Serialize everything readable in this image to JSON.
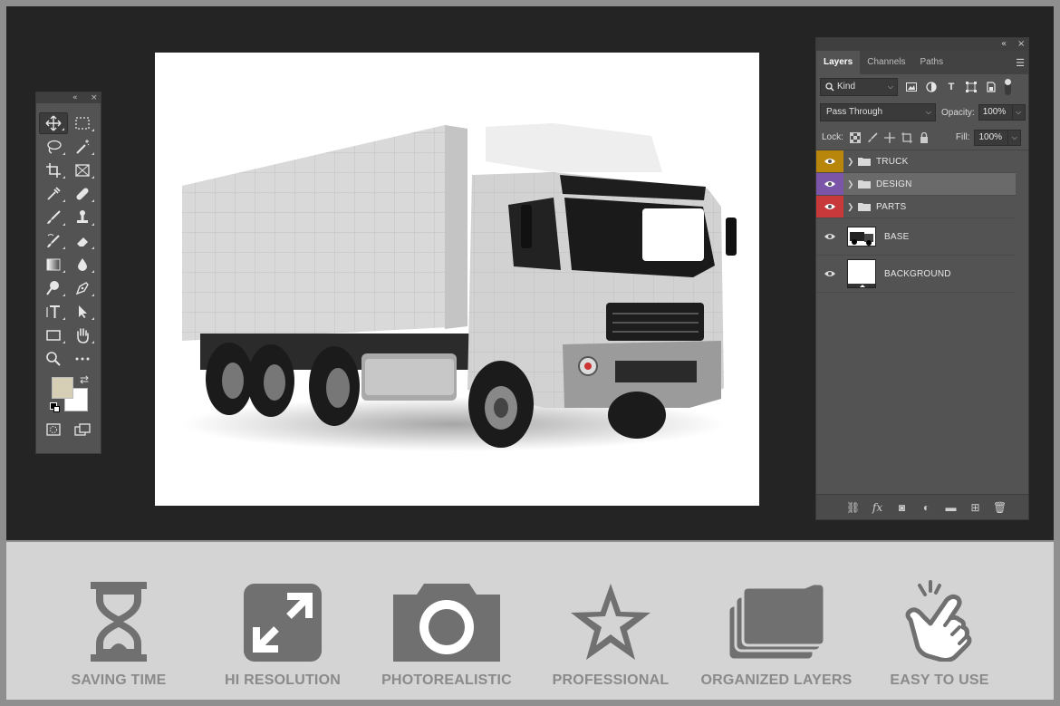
{
  "tools_panel": {
    "collapse_icon": "«",
    "close_icon": "×"
  },
  "layers_panel": {
    "collapse_icon": "«",
    "close_icon": "×",
    "tabs": [
      "Layers",
      "Channels",
      "Paths"
    ],
    "filter": {
      "label": "Kind"
    },
    "blend_mode": "Pass Through",
    "opacity_label": "Opacity:",
    "opacity_value": "100%",
    "lock_label": "Lock:",
    "fill_label": "Fill:",
    "fill_value": "100%",
    "layers": [
      {
        "name": "TRUCK",
        "type": "group",
        "color": "#b8860b"
      },
      {
        "name": "DESIGN",
        "type": "group",
        "color": "#7b55a8",
        "selected": true
      },
      {
        "name": "PARTS",
        "type": "group",
        "color": "#c8393b"
      },
      {
        "name": "BASE",
        "type": "layer"
      },
      {
        "name": "BACKGROUND",
        "type": "layer"
      }
    ]
  },
  "colors": {
    "foreground": "#d6cfb6",
    "background": "#ffffff",
    "workspace": "#242424",
    "panel": "#535353"
  },
  "features": [
    {
      "label": "SAVING TIME",
      "icon": "hourglass-icon"
    },
    {
      "label": "HI RESOLUTION",
      "icon": "expand-arrows-icon"
    },
    {
      "label": "PHOTOREALISTIC",
      "icon": "camera-icon"
    },
    {
      "label": "PROFESSIONAL",
      "icon": "star-icon"
    },
    {
      "label": "ORGANIZED LAYERS",
      "icon": "stacked-folders-icon"
    },
    {
      "label": "EASY TO USE",
      "icon": "pointing-hand-icon"
    }
  ]
}
